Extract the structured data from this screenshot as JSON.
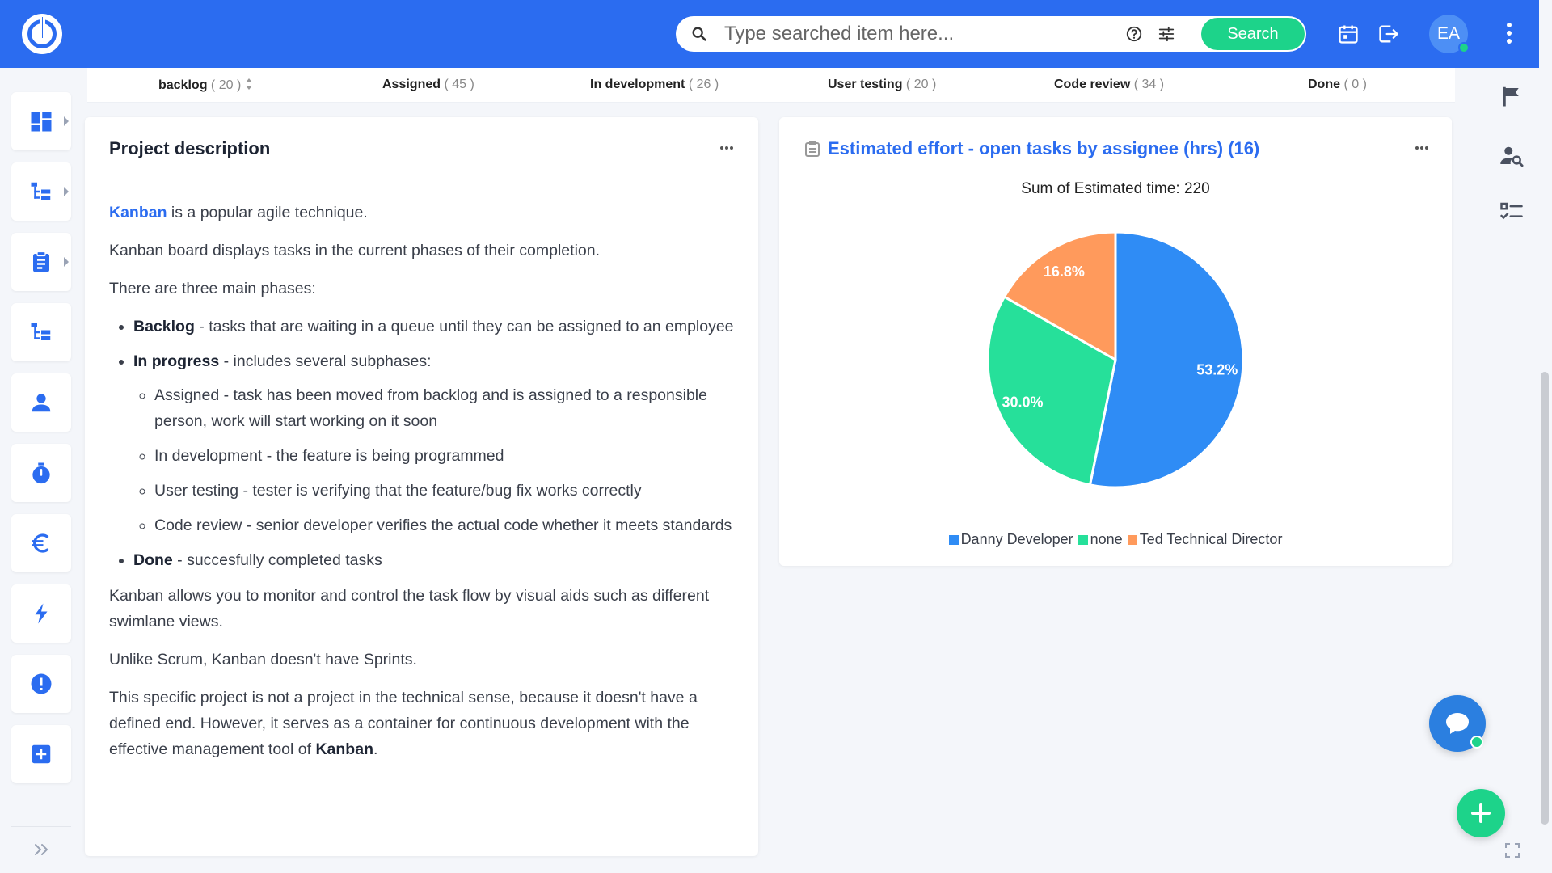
{
  "colors": {
    "brand": "#2b6cf0",
    "accent_green": "#1dd38a",
    "series_blue": "#2f8cf5",
    "series_green": "#26e09a",
    "series_orange": "#ff9a5c"
  },
  "header": {
    "logo_icon": "app-logo",
    "search": {
      "placeholder": "Type searched item here...",
      "button_label": "Search"
    },
    "icons": [
      "search-icon",
      "help-icon",
      "tune-icon",
      "calendar-icon",
      "logout-icon",
      "more-vertical-icon"
    ],
    "avatar_initials": "EA"
  },
  "sidebar": {
    "items": [
      {
        "icon": "dashboard-icon",
        "has_submenu": true
      },
      {
        "icon": "hierarchy-icon",
        "has_submenu": true
      },
      {
        "icon": "clipboard-icon",
        "has_submenu": true
      },
      {
        "icon": "hierarchy-icon",
        "has_submenu": false
      },
      {
        "icon": "user-icon",
        "has_submenu": false
      },
      {
        "icon": "timer-icon",
        "has_submenu": false
      },
      {
        "icon": "euro-icon",
        "has_submenu": false
      },
      {
        "icon": "lightning-icon",
        "has_submenu": false
      },
      {
        "icon": "alert-icon",
        "has_submenu": false
      },
      {
        "icon": "add-box-icon",
        "has_submenu": false
      }
    ]
  },
  "right_sidebar": {
    "icons": [
      "flag-icon",
      "user-search-icon",
      "checklist-icon"
    ]
  },
  "phases": [
    {
      "name": "backlog",
      "count": "( 20 )"
    },
    {
      "name": "Assigned",
      "count": "( 45 )"
    },
    {
      "name": "In development",
      "count": "( 26 )"
    },
    {
      "name": "User testing",
      "count": "( 20 )"
    },
    {
      "name": "Code review",
      "count": "( 34 )"
    },
    {
      "name": "Done",
      "count": "( 0 )"
    }
  ],
  "description": {
    "title": "Project description",
    "intro_keyword": "Kanban",
    "intro_rest": " is a popular agile technique.",
    "p2": "Kanban board displays tasks in the current phases of their completion.",
    "p3": "There are three main phases:",
    "backlog_term": "Backlog",
    "backlog_text": " - tasks that are waiting in a queue until they can be assigned to an employee",
    "inprogress_term": "In progress",
    "inprogress_text": " - includes several subphases:",
    "sub1": "Assigned - task has been moved from backlog and is assigned to a responsible person, work will start working on it soon",
    "sub2": "In development - the feature is being programmed",
    "sub3": "User testing - tester is verifying that the feature/bug fix works correctly",
    "sub4": "Code review - senior developer verifies the actual code whether it meets standards",
    "done_term": "Done",
    "done_text": " - succesfully completed tasks",
    "p4": "Kanban allows you to monitor and control the task flow by visual aids such as different swimlane views.",
    "p5": "Unlike Scrum, Kanban doesn't have Sprints.",
    "p6_text": "This specific project is not a project in the technical sense, because it doesn't have a defined end. However, it serves as a container for continuous development with the effective management tool of ",
    "p6_bold": "Kanban",
    "p6_end": "."
  },
  "chart_panel": {
    "title": "Estimated effort - open tasks by assignee (hrs) (16)",
    "subtitle": "Sum of Estimated time: 220"
  },
  "chart_data": {
    "type": "pie",
    "title": "Estimated effort - open tasks by assignee (hrs) (16)",
    "subtitle": "Sum of Estimated time: 220",
    "slices": [
      {
        "label": "Danny Developer",
        "percent": 53.2,
        "display": "53.2%",
        "color": "#2f8cf5"
      },
      {
        "label": "none",
        "percent": 30.0,
        "display": "30.0%",
        "color": "#26e09a"
      },
      {
        "label": "Ted Technical Director",
        "percent": 16.8,
        "display": "16.8%",
        "color": "#ff9a5c"
      }
    ],
    "legend_position": "bottom"
  }
}
